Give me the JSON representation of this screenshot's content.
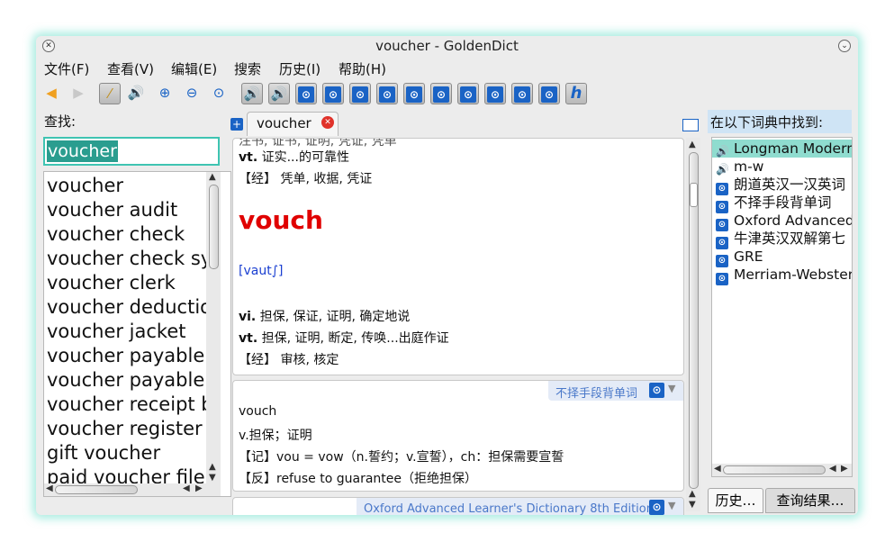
{
  "window": {
    "title": "voucher - GoldenDict",
    "close_glyph": "✕",
    "menu_glyph": "⌄"
  },
  "menubar": {
    "items": [
      "文件(F)",
      "查看(V)",
      "编辑(E)",
      "搜索",
      "历史(I)",
      "帮助(H)"
    ]
  },
  "toolbar": {
    "back_icon": "back-arrow-icon",
    "forward_icon": "forward-arrow-icon",
    "wand_icon": "magic-wand-icon",
    "speaker_icon": "speaker-icon",
    "dict_letter": "h"
  },
  "search": {
    "label": "查找:",
    "value": "voucher"
  },
  "word_list": {
    "items": [
      "voucher",
      "voucher audit",
      "voucher check",
      "voucher check sy",
      "voucher clerk",
      "voucher deductio",
      "voucher jacket",
      "voucher payable",
      "voucher payable",
      "voucher receipt b",
      "voucher register",
      "gift voucher",
      "paid voucher file",
      "                 "
    ]
  },
  "tabs": {
    "add_label": "+",
    "active_tab": "voucher",
    "close_glyph": "✕"
  },
  "article1": {
    "top_partial": "注书, 证书, 证明, 凭证, 凭单",
    "line1_pos": "vt.",
    "line1_text": " 证实...的可靠性",
    "line2": "【经】 凭单, 收据, 凭证",
    "headword": "vouch",
    "phonetic": "[vaut∫]",
    "line3_pos": "vi.",
    "line3_text": " 担保, 保证, 证明, 确定地说",
    "line4_pos": "vt.",
    "line4_text": " 担保, 证明, 断定, 传唤...出庭作证",
    "line5": "【经】 审核, 核定"
  },
  "article2": {
    "dict_name": "不择手段背单词",
    "word": "vouch",
    "line1": "v.担保；证明",
    "line2": "【记】vou = vow（n.誓约；v.宣誓），ch：担保需要宣誓",
    "line3": "【反】refuse to guarantee（拒绝担保）"
  },
  "article3": {
    "dict_name": "Oxford Advanced Learner's Dictionary 8th Edition"
  },
  "found_panel": {
    "label": "在以下词典中找到:",
    "items": [
      {
        "name": "Longman Modern",
        "icon": "speaker-icon"
      },
      {
        "name": "m-w",
        "icon": "speaker-icon"
      },
      {
        "name": "朗道英汉一汉英词",
        "icon": "dictionary-icon"
      },
      {
        "name": "不择手段背单词",
        "icon": "dictionary-icon"
      },
      {
        "name": "Oxford Advanced",
        "icon": "dictionary-icon"
      },
      {
        "name": "牛津英汉双解第七",
        "icon": "dictionary-icon"
      },
      {
        "name": "GRE",
        "icon": "dictionary-icon"
      },
      {
        "name": "Merriam-Webster",
        "icon": "dictionary-icon"
      }
    ]
  },
  "bottom_tabs": {
    "history": "历史…",
    "results": "查询结果…"
  },
  "colors": {
    "accent": "#2a9d8f",
    "headword": "#e00000",
    "phonetic": "#1a3fd1",
    "dict_header": "#4a78c9"
  }
}
